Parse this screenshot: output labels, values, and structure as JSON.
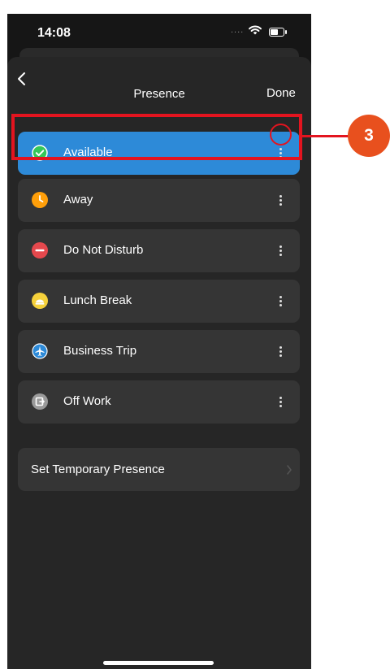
{
  "status_bar": {
    "time": "14:08",
    "signal_dots": "....",
    "wifi_icon": "wifi-icon",
    "battery_icon": "battery-icon"
  },
  "nav": {
    "back_icon": "chevron-left-icon",
    "title": "Presence",
    "done_label": "Done"
  },
  "presence_options": [
    {
      "label": "Available",
      "icon": "check-circle-icon",
      "color": "#34c759",
      "selected": true
    },
    {
      "label": "Away",
      "icon": "clock-icon",
      "color": "#ff9f0a",
      "selected": false
    },
    {
      "label": "Do Not Disturb",
      "icon": "minus-circle-icon",
      "color": "#e5484d",
      "selected": false
    },
    {
      "label": "Lunch Break",
      "icon": "meal-icon",
      "color": "#f5d13b",
      "selected": false
    },
    {
      "label": "Business Trip",
      "icon": "airplane-icon",
      "color": "#2d8ad8",
      "selected": false
    },
    {
      "label": "Off Work",
      "icon": "exit-icon",
      "color": "#9a9a9a",
      "selected": false
    }
  ],
  "temporary_presence": {
    "label": "Set Temporary Presence",
    "icon": "chevron-right-icon"
  },
  "annotation": {
    "step_number": "3",
    "color": "#e3141f",
    "badge_color": "#e8501e"
  },
  "colors": {
    "selected_row": "#2d8ad8",
    "row_bg": "#353535",
    "sheet_bg": "#262626"
  }
}
